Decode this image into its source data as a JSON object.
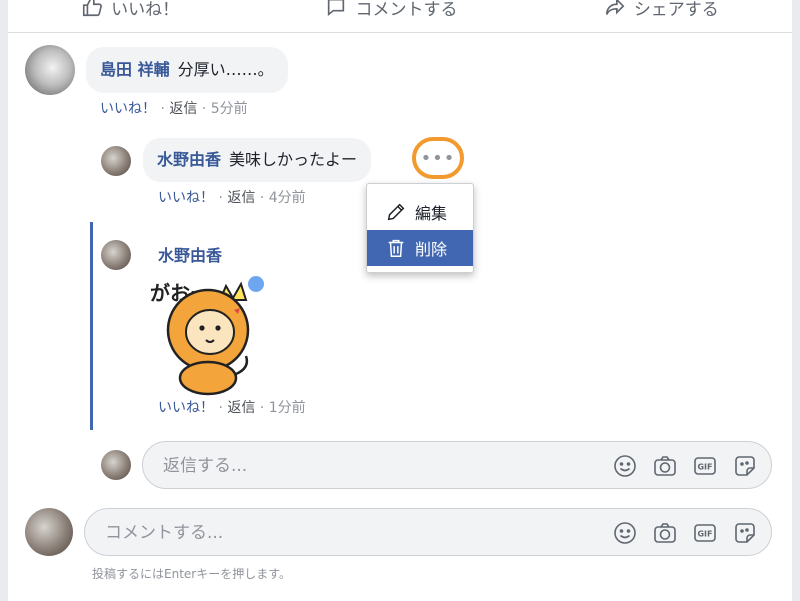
{
  "actions": {
    "like": "いいね！",
    "comment": "コメントする",
    "share": "シェアする"
  },
  "comment1": {
    "author": "島田 祥輔",
    "text": "分厚い……。",
    "like": "いいね！",
    "reply": "返信",
    "time": "5分前"
  },
  "reply1": {
    "author": "水野由香",
    "text": "美味しかったよー",
    "like": "いいね！",
    "reply": "返信",
    "time": "4分前",
    "more": "•••"
  },
  "menu": {
    "edit": "編集",
    "delete": "削除"
  },
  "reply2": {
    "author": "水野由香",
    "sticker_text": "がおー",
    "like": "いいね！",
    "reply": "返信",
    "time": "1分前"
  },
  "reply_input": {
    "placeholder": "返信する..."
  },
  "comment_input": {
    "placeholder": "コメントする..."
  },
  "hint": "投稿するにはEnterキーを押します。",
  "sep": " · ",
  "colors": {
    "link": "#385898",
    "accent": "#4267b2",
    "highlight": "#f29a2e"
  }
}
